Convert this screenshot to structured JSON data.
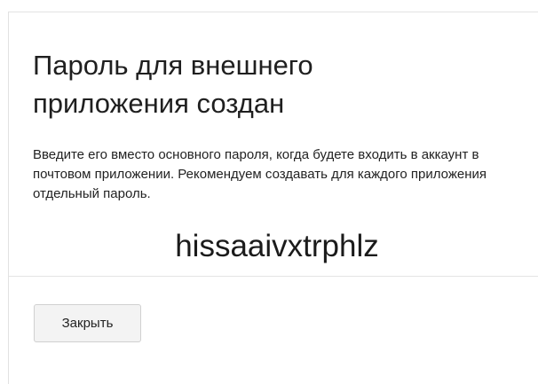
{
  "dialog": {
    "title": "Пароль для внешнего приложения создан",
    "description": "Введите его вместо основного пароля, когда будете входить в аккаунт в почтовом приложении. Рекомендуем создавать для каждого приложения отдельный пароль.",
    "generated_password": "hissaaivxtrphlz",
    "close_label": "Закрыть"
  }
}
